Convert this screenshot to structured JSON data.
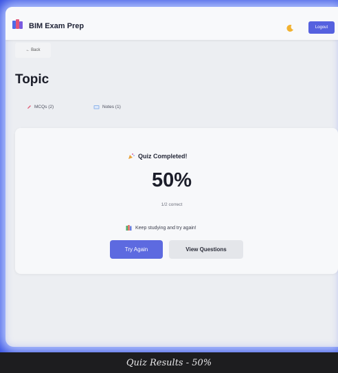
{
  "header": {
    "app_title": "BIM Exam Prep",
    "logout_label": "Logout",
    "theme_icon": "moon-icon",
    "logo_icon": "books-icon"
  },
  "nav": {
    "back_label": "← Back"
  },
  "page": {
    "title": "Topic"
  },
  "tabs": [
    {
      "label": "MCQs (2)",
      "icon": "pencil-icon"
    },
    {
      "label": "Notes (1)",
      "icon": "notebook-icon"
    }
  ],
  "result": {
    "heading": "Quiz Completed!",
    "heading_icon": "party-popper-icon",
    "score": "50%",
    "correct_text": "1/2 correct",
    "message": "Keep studying and try again!",
    "message_icon": "books-icon"
  },
  "actions": {
    "try_again_label": "Try Again",
    "view_questions_label": "View Questions"
  },
  "caption": "Quiz Results - 50%",
  "colors": {
    "accent": "#5d6ae0",
    "frame_glow": "#2d48e0"
  }
}
